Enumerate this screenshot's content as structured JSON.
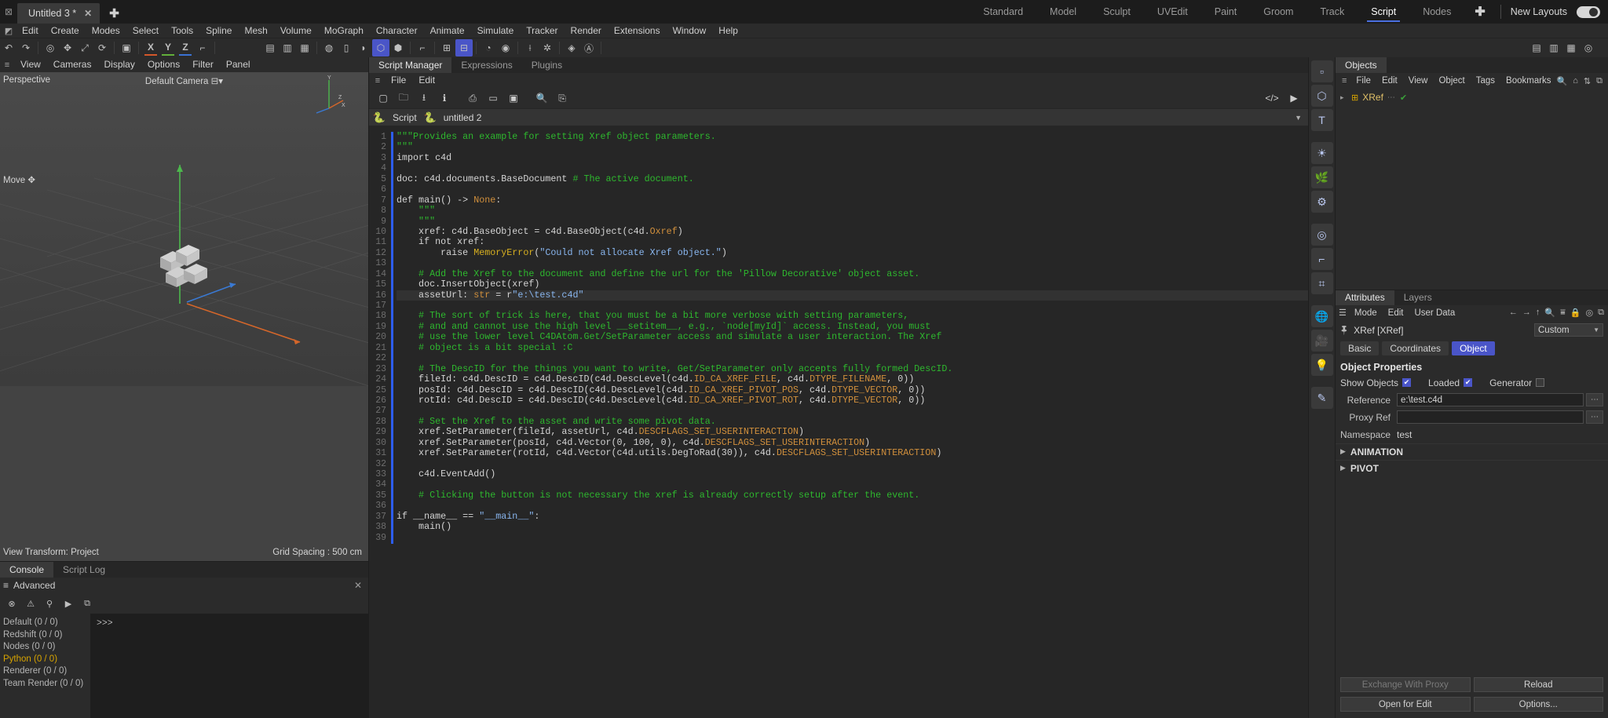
{
  "window": {
    "doc_tab": "Untitled 3 *",
    "close_label": "✕",
    "new_tab_label": "✚"
  },
  "layouts": {
    "items": [
      "Standard",
      "Model",
      "Sculpt",
      "UVEdit",
      "Paint",
      "Groom",
      "Track",
      "Script",
      "Nodes"
    ],
    "active": "Script",
    "plus": "✚",
    "new_layouts_label": "New Layouts"
  },
  "main_menu": [
    "Edit",
    "Create",
    "Modes",
    "Select",
    "Tools",
    "Spline",
    "Mesh",
    "Volume",
    "MoGraph",
    "Character",
    "Animate",
    "Simulate",
    "Tracker",
    "Render",
    "Extensions",
    "Window",
    "Help"
  ],
  "viewport_menu": [
    "View",
    "Cameras",
    "Display",
    "Options",
    "Filter",
    "Panel"
  ],
  "viewport": {
    "perspective_label": "Perspective",
    "camera_label": "Default Camera",
    "move_label": "Move",
    "view_transform_label": "View Transform: Project",
    "grid_spacing_label": "Grid Spacing : 500 cm",
    "axis_x": "X",
    "axis_y": "Y",
    "axis_z": "Z"
  },
  "axis_toolbar": {
    "x": "X",
    "y": "Y",
    "z": "Z"
  },
  "console": {
    "tabs": [
      "Console",
      "Script Log"
    ],
    "active_tab": "Console",
    "advanced_label": "Advanced",
    "close": "✕",
    "counters": [
      {
        "label": "Default (0 / 0)",
        "highlight": false
      },
      {
        "label": "Redshift (0 / 0)",
        "highlight": false
      },
      {
        "label": "Nodes (0 / 0)",
        "highlight": false
      },
      {
        "label": "Python (0 / 0)",
        "highlight": true
      },
      {
        "label": "Renderer (0 / 0)",
        "highlight": false
      },
      {
        "label": "Team Render  (0 / 0)",
        "highlight": false
      }
    ],
    "prompt": ">>>"
  },
  "script_manager": {
    "tabs": [
      "Script Manager",
      "Expressions",
      "Plugins"
    ],
    "active_tab": "Script Manager",
    "menu": [
      "File",
      "Edit"
    ],
    "script_label": "Script",
    "file_name": "untitled 2"
  },
  "code": {
    "line_count": 39,
    "highlight_line": 16,
    "lines": [
      [
        [
          "\"\"\"Provides an example for setting Xref object parameters.",
          "doc"
        ]
      ],
      [
        [
          "\"\"\"",
          "doc"
        ]
      ],
      [
        [
          "import",
          "kw"
        ],
        [
          " c4d",
          "plain"
        ]
      ],
      [],
      [
        [
          "doc: c4d.documents.BaseDocument ",
          "plain"
        ],
        [
          "# The active document.",
          "com"
        ]
      ],
      [],
      [
        [
          "def main() -> ",
          "plain"
        ],
        [
          "None",
          "const"
        ],
        [
          ":",
          "plain"
        ]
      ],
      [
        [
          "    \"\"\"",
          "doc"
        ]
      ],
      [
        [
          "    \"\"\"",
          "doc"
        ]
      ],
      [
        [
          "    xref: c4d.BaseObject = c4d.BaseObject(c4d.",
          "plain"
        ],
        [
          "Oxref",
          "id"
        ],
        [
          ")",
          "plain"
        ]
      ],
      [
        [
          "    if not xref:",
          "plain"
        ]
      ],
      [
        [
          "        raise ",
          "plain"
        ],
        [
          "MemoryError",
          "err"
        ],
        [
          "(",
          "plain"
        ],
        [
          "\"Could not allocate Xref object.\"",
          "str"
        ],
        [
          ")",
          "plain"
        ]
      ],
      [],
      [
        [
          "    # Add the Xref to the document and define the url for the 'Pillow Decorative' object asset.",
          "com"
        ]
      ],
      [
        [
          "    doc.InsertObject(xref)",
          "plain"
        ]
      ],
      [
        [
          "    assetUrl: ",
          "plain"
        ],
        [
          "str",
          "id"
        ],
        [
          " = r",
          "plain"
        ],
        [
          "\"e:\\test.c4d\"",
          "str"
        ]
      ],
      [],
      [
        [
          "    # The sort of trick is here, that you must be a bit more verbose with setting parameters,",
          "com"
        ]
      ],
      [
        [
          "    # and and cannot use the high level __setitem__, e.g., `node[myId]` access. Instead, you must",
          "com"
        ]
      ],
      [
        [
          "    # use the lower level C4DAtom.Get/SetParameter access and simulate a user interaction. The Xref",
          "com"
        ]
      ],
      [
        [
          "    # object is a bit special :C",
          "com"
        ]
      ],
      [],
      [
        [
          "    # The DescID for the things you want to write, Get/SetParameter only accepts fully formed DescID.",
          "com"
        ]
      ],
      [
        [
          "    fileId: c4d.DescID = c4d.DescID(c4d.DescLevel(c4d.",
          "plain"
        ],
        [
          "ID_CA_XREF_FILE",
          "id"
        ],
        [
          ", c4d.",
          "plain"
        ],
        [
          "DTYPE_FILENAME",
          "id"
        ],
        [
          ", 0))",
          "plain"
        ]
      ],
      [
        [
          "    posId: c4d.DescID = c4d.DescID(c4d.DescLevel(c4d.",
          "plain"
        ],
        [
          "ID_CA_XREF_PIVOT_POS",
          "id"
        ],
        [
          ", c4d.",
          "plain"
        ],
        [
          "DTYPE_VECTOR",
          "id"
        ],
        [
          ", 0))",
          "plain"
        ]
      ],
      [
        [
          "    rotId: c4d.DescID = c4d.DescID(c4d.DescLevel(c4d.",
          "plain"
        ],
        [
          "ID_CA_XREF_PIVOT_ROT",
          "id"
        ],
        [
          ", c4d.",
          "plain"
        ],
        [
          "DTYPE_VECTOR",
          "id"
        ],
        [
          ", 0))",
          "plain"
        ]
      ],
      [],
      [
        [
          "    # Set the Xref to the asset and write some pivot data.",
          "com"
        ]
      ],
      [
        [
          "    xref.SetParameter(fileId, assetUrl, c4d.",
          "plain"
        ],
        [
          "DESCFLAGS_SET_USERINTERACTION",
          "id"
        ],
        [
          ")",
          "plain"
        ]
      ],
      [
        [
          "    xref.SetParameter(posId, c4d.Vector(0, 100, 0), c4d.",
          "plain"
        ],
        [
          "DESCFLAGS_SET_USERINTERACTION",
          "id"
        ],
        [
          ")",
          "plain"
        ]
      ],
      [
        [
          "    xref.SetParameter(rotId, c4d.Vector(c4d.utils.DegToRad(30)), c4d.",
          "plain"
        ],
        [
          "DESCFLAGS_SET_USERINTERACTION",
          "id"
        ],
        [
          ")",
          "plain"
        ]
      ],
      [],
      [
        [
          "    c4d.EventAdd()",
          "plain"
        ]
      ],
      [],
      [
        [
          "    # Clicking the button is not necessary the xref is already correctly setup after the event.",
          "com"
        ]
      ],
      [],
      [
        [
          "if ",
          "plain"
        ],
        [
          "__name__",
          "plain"
        ],
        [
          " == ",
          "plain"
        ],
        [
          "\"__main__\"",
          "str"
        ],
        [
          ":",
          "plain"
        ]
      ],
      [
        [
          "    main()",
          "plain"
        ]
      ],
      []
    ]
  },
  "objects": {
    "tab": "Objects",
    "menu": [
      "File",
      "Edit",
      "View",
      "Object",
      "Tags",
      "Bookmarks"
    ],
    "rows": [
      {
        "name": "XRef",
        "dots": "⋯",
        "check": "✔"
      }
    ]
  },
  "attributes": {
    "tabs": [
      "Attributes",
      "Layers"
    ],
    "active_tab": "Attributes",
    "menu": [
      "Mode",
      "Edit",
      "User Data"
    ],
    "object_name": "XRef [XRef]",
    "preset": "Custom",
    "subtabs": [
      "Basic",
      "Coordinates",
      "Object"
    ],
    "active_subtab": "Object",
    "section_title": "Object Properties",
    "checkboxes": [
      {
        "label": "Show Objects",
        "checked": true
      },
      {
        "label": "Loaded",
        "checked": true
      },
      {
        "label": "Generator",
        "checked": false
      }
    ],
    "fields": [
      {
        "label": "Reference",
        "value": "e:\\test.c4d",
        "has_button": true
      },
      {
        "label": "Proxy Ref",
        "value": "",
        "has_button": true
      },
      {
        "label": "Namespace",
        "value": "test",
        "has_button": false
      }
    ],
    "folders": [
      "ANIMATION",
      "PIVOT"
    ],
    "buttons": [
      {
        "label": "Exchange With Proxy",
        "disabled": true
      },
      {
        "label": "Reload",
        "disabled": false
      },
      {
        "label": "Open for Edit",
        "disabled": false
      },
      {
        "label": "Options...",
        "disabled": false
      }
    ]
  },
  "colors": {
    "accent": "#4a55c8",
    "comment_green": "#2eb82e",
    "string_blue": "#89b6ef",
    "identifier_orange": "#d08f3c"
  }
}
